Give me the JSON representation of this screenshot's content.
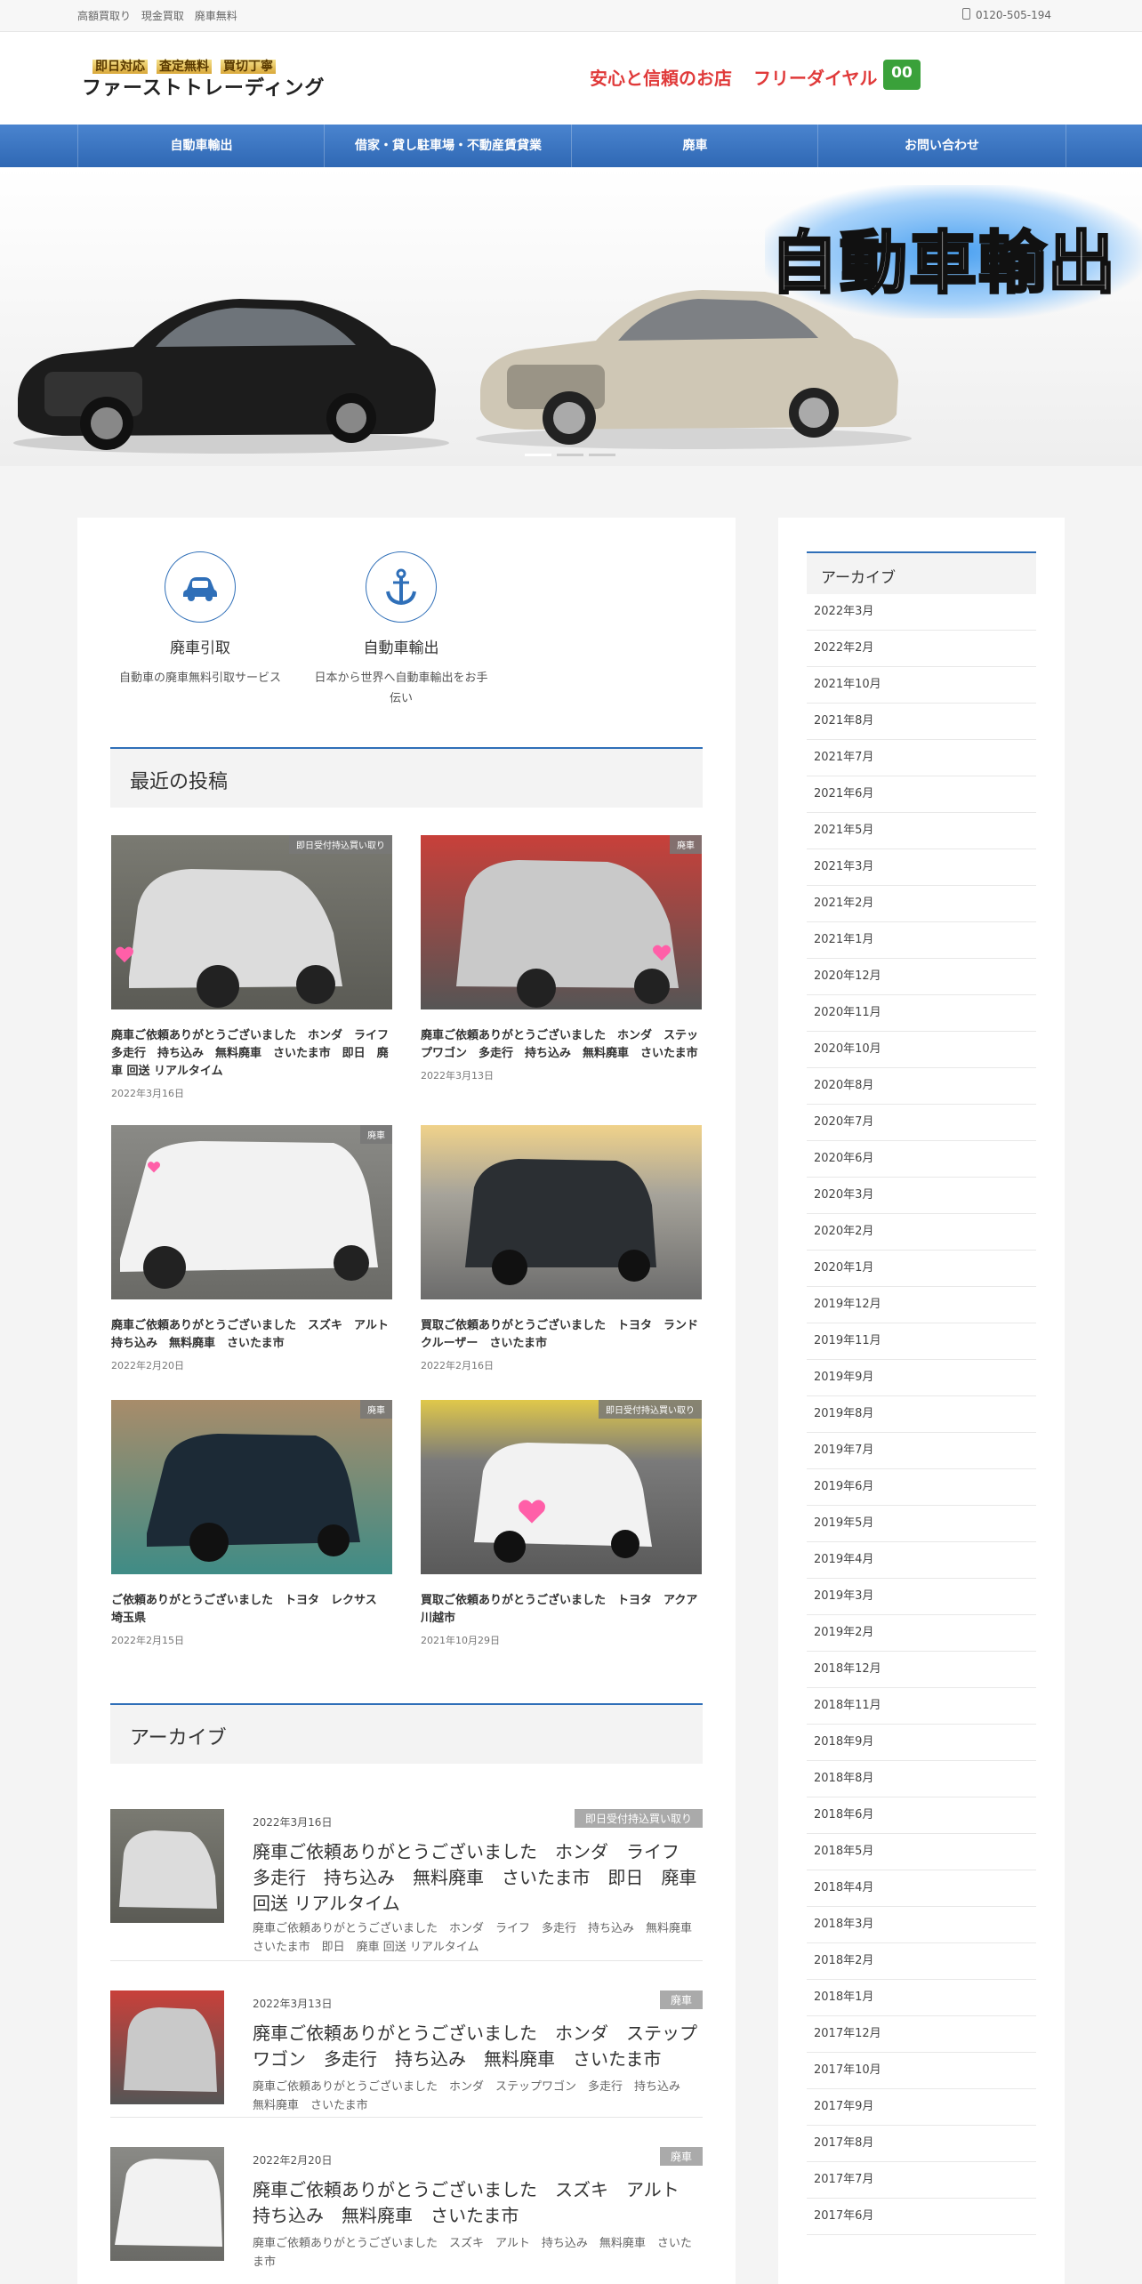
{
  "topbar": {
    "links": [
      "高額買取り",
      "現金買取",
      "廃車無料"
    ],
    "phone": "0120-505-194"
  },
  "header": {
    "tags": [
      "即日対応",
      "査定無料",
      "買切丁寧"
    ],
    "site_name": "ファーストトレーディング",
    "slogan_1": "安心と信頼のお店",
    "slogan_2": "フリーダイヤル",
    "free_dial_mark": "00"
  },
  "nav": [
    "自動車輸出",
    "借家・貸し駐車場・不動産賃貸業",
    "廃車",
    "お問い合わせ"
  ],
  "hero": {
    "title": "自動車輸出",
    "slides": 3,
    "active_slide": 1
  },
  "services": [
    {
      "title": "廃車引取",
      "desc": "自動車の廃車無料引取サービス",
      "icon": "car-icon"
    },
    {
      "title": "自動車輸出",
      "desc": "日本から世界へ自動車輸出をお手伝い",
      "icon": "anchor-icon"
    }
  ],
  "recent": {
    "heading": "最近の投稿",
    "posts": [
      {
        "title": "廃車ご依頼ありがとうございました　ホンダ　ライフ　多走行　持ち込み　無料廃車　さいたま市　即日　廃車 回送 リアルタイム",
        "date": "2022年3月16日",
        "category": "即日受付持込買い取り"
      },
      {
        "title": "廃車ご依頼ありがとうございました　ホンダ　ステップワゴン　多走行　持ち込み　無料廃車　さいたま市",
        "date": "2022年3月13日",
        "category": "廃車"
      },
      {
        "title": "廃車ご依頼ありがとうございました　スズキ　アルト　持ち込み　無料廃車　さいたま市",
        "date": "2022年2月20日",
        "category": "廃車"
      },
      {
        "title": "買取ご依頼ありがとうございました　トヨタ　ランドクルーザー　さいたま市",
        "date": "2022年2月16日",
        "category": ""
      },
      {
        "title": "ご依頼ありがとうございました　トヨタ　レクサス　埼玉県",
        "date": "2022年2月15日",
        "category": "廃車"
      },
      {
        "title": "買取ご依頼ありがとうございました　トヨタ　アクア　川越市",
        "date": "2021年10月29日",
        "category": "即日受付持込買い取り"
      }
    ]
  },
  "archive": {
    "heading": "アーカイブ",
    "items": [
      {
        "date": "2022年3月16日",
        "category": "即日受付持込買い取り",
        "title": "廃車ご依頼ありがとうございました　ホンダ　ライフ　多走行　持ち込み　無料廃車　さいたま市　即日　廃車 回送 リアルタイム",
        "excerpt": "廃車ご依頼ありがとうございました　ホンダ　ライフ　多走行　持ち込み　無料廃車　さいたま市　即日　廃車 回送 リアルタイム"
      },
      {
        "date": "2022年3月13日",
        "category": "廃車",
        "title": "廃車ご依頼ありがとうございました　ホンダ　ステップワゴン　多走行　持ち込み　無料廃車　さいたま市",
        "excerpt": "廃車ご依頼ありがとうございました　ホンダ　ステップワゴン　多走行　持ち込み　無料廃車　さいたま市"
      },
      {
        "date": "2022年2月20日",
        "category": "廃車",
        "title": "廃車ご依頼ありがとうございました　スズキ　アルト　持ち込み　無料廃車　さいたま市",
        "excerpt": "廃車ご依頼ありがとうございました　スズキ　アルト　持ち込み　無料廃車　さいたま市"
      }
    ]
  },
  "sidebar": {
    "heading": "アーカイブ",
    "months": [
      "2022年3月",
      "2022年2月",
      "2021年10月",
      "2021年8月",
      "2021年7月",
      "2021年6月",
      "2021年5月",
      "2021年3月",
      "2021年2月",
      "2021年1月",
      "2020年12月",
      "2020年11月",
      "2020年10月",
      "2020年8月",
      "2020年7月",
      "2020年6月",
      "2020年3月",
      "2020年2月",
      "2020年1月",
      "2019年12月",
      "2019年11月",
      "2019年9月",
      "2019年8月",
      "2019年7月",
      "2019年6月",
      "2019年5月",
      "2019年4月",
      "2019年3月",
      "2019年2月",
      "2018年12月",
      "2018年11月",
      "2018年9月",
      "2018年8月",
      "2018年6月",
      "2018年5月",
      "2018年4月",
      "2018年3月",
      "2018年2月",
      "2018年1月",
      "2017年12月",
      "2017年10月",
      "2017年9月",
      "2017年8月",
      "2017年7月",
      "2017年6月"
    ]
  }
}
